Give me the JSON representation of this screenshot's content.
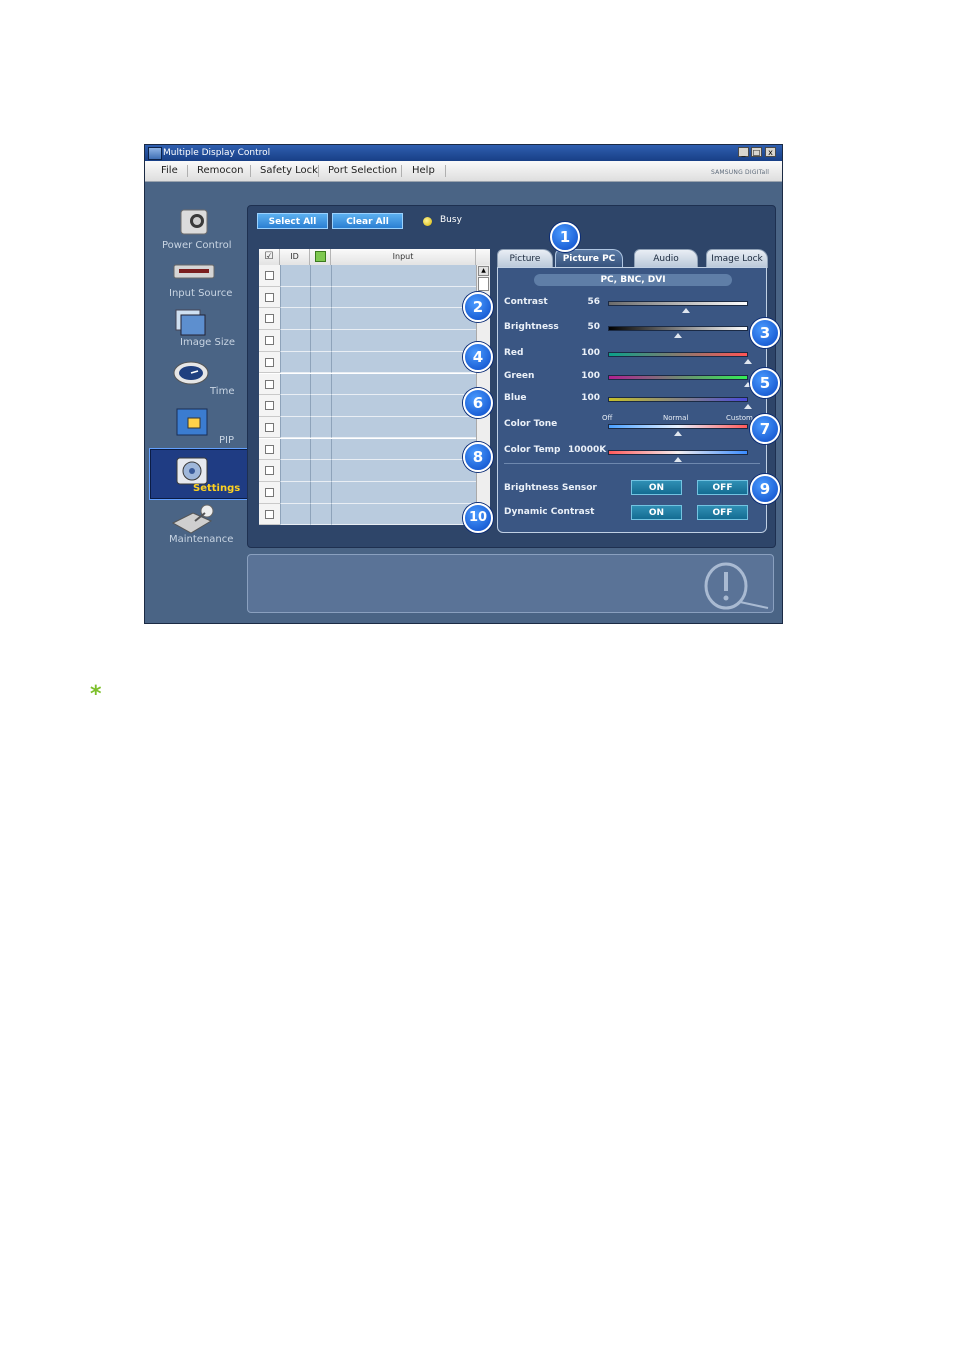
{
  "window": {
    "title": "Multiple Display Control",
    "brand": "SAMSUNG DIGITall",
    "controls": {
      "minimize": "_",
      "maximize": "□",
      "close": "x"
    }
  },
  "menu": [
    "File",
    "Remocon",
    "Safety Lock",
    "Port Selection",
    "Help"
  ],
  "sidebar": [
    {
      "label": "Power Control",
      "icon": "power-control-icon",
      "active": false
    },
    {
      "label": "Input Source",
      "icon": "input-source-icon",
      "active": false
    },
    {
      "label": "Image Size",
      "icon": "image-size-icon",
      "active": false
    },
    {
      "label": "Time",
      "icon": "clock-icon",
      "active": false
    },
    {
      "label": "PIP",
      "icon": "pip-icon",
      "active": false
    },
    {
      "label": "Settings",
      "icon": "settings-icon",
      "active": true
    },
    {
      "label": "Maintenance",
      "icon": "maintenance-icon",
      "active": false
    }
  ],
  "toolbar": {
    "select_all": "Select All",
    "clear_all": "Clear All",
    "busy_label": "Busy"
  },
  "grid": {
    "headers": {
      "check": "☑",
      "id": "ID",
      "input": "Input"
    },
    "row_count": 12
  },
  "tabs": [
    {
      "label": "Picture",
      "active": false
    },
    {
      "label": "Picture PC",
      "active": true
    },
    {
      "label": "Audio",
      "active": false
    },
    {
      "label": "Image Lock",
      "active": false
    }
  ],
  "settings": {
    "source": "PC, BNC, DVI",
    "contrast": {
      "label": "Contrast",
      "value": "56",
      "level": 56
    },
    "brightness": {
      "label": "Brightness",
      "value": "50",
      "level": 50
    },
    "red": {
      "label": "Red",
      "value": "100",
      "level": 100
    },
    "green": {
      "label": "Green",
      "value": "100",
      "level": 100
    },
    "blue": {
      "label": "Blue",
      "value": "100",
      "level": 100
    },
    "color_tone": {
      "label": "Color Tone",
      "options": [
        "Off",
        "Normal",
        "Custom"
      ],
      "selected": "Normal"
    },
    "color_temp": {
      "label": "Color Temp",
      "value": "10000K",
      "level": 50
    },
    "brightness_sensor": {
      "label": "Brightness Sensor",
      "on": "ON",
      "off": "OFF"
    },
    "dynamic_contrast": {
      "label": "Dynamic Contrast",
      "on": "ON",
      "off": "OFF"
    }
  },
  "callouts": [
    "1",
    "2",
    "3",
    "4",
    "5",
    "6",
    "7",
    "8",
    "9",
    "10"
  ],
  "note_symbol": "*",
  "colors": {
    "accent": "#2b7fd2",
    "callout": "#0a49c6",
    "note": "#7cbf2a",
    "busy": "#d4b400"
  }
}
